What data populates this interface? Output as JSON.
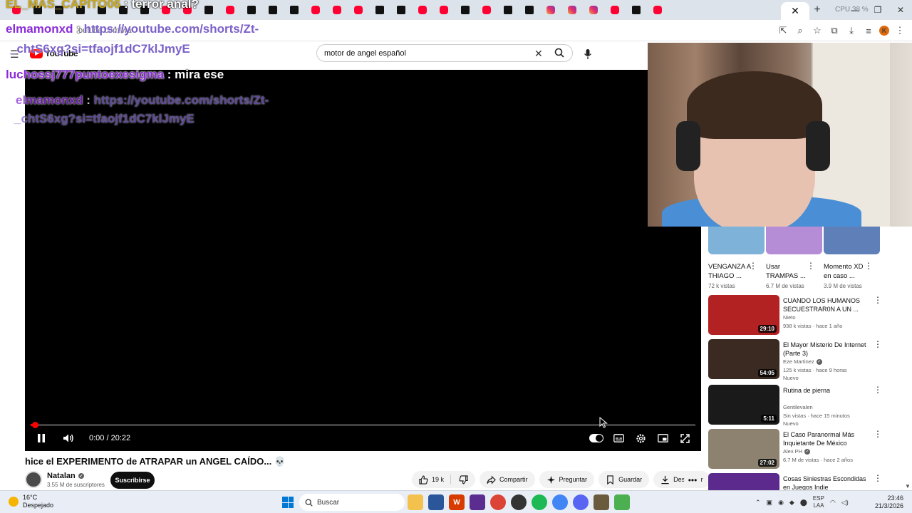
{
  "browser": {
    "url_fragment": "outube.com/wa",
    "cpu_label": "CPU 38 %",
    "new_tab_symbol": "+",
    "close_tab_symbol": "✕",
    "profile_initial": "K",
    "tab_favicons": [
      "yt",
      "tt",
      "tt",
      "tt",
      "tt",
      "tt",
      "tt",
      "yt",
      "yt",
      "tt",
      "yt",
      "tt",
      "tt",
      "tt",
      "yt",
      "yt",
      "yt",
      "tt",
      "tt",
      "yt",
      "yt",
      "tt",
      "yt",
      "tt",
      "tt",
      "ig",
      "ig",
      "ig",
      "yt",
      "tt",
      "yt"
    ]
  },
  "youtube": {
    "logo_text": "YouTube",
    "search": {
      "value": "motor de angel español"
    },
    "player": {
      "time": "0:00 / 20:22",
      "progress": 0.01
    },
    "video": {
      "title": "hice el EXPERIMENTO de ATRAPAR un ANGEL CAÍDO... 💀",
      "channel": "Natalan",
      "subscribers": "3.55 M de suscriptores",
      "subscribe_label": "Suscribirse",
      "likes": "19 k",
      "share_label": "Compartir",
      "ask_label": "Preguntar",
      "save_label": "Guardar",
      "download_label": "Descargar"
    },
    "shorts": [
      {
        "title": "VENGANZA A THIAGO ...",
        "views": "72 k vistas",
        "color": "#7fb2d8"
      },
      {
        "title": "Usar TRAMPAS ...",
        "views": "6.7 M de vistas",
        "color": "#b58cd6"
      },
      {
        "title": "Momento XD en caso ...",
        "views": "3.9 M de vistas",
        "color": "#5f7fb8"
      }
    ],
    "recommendations": [
      {
        "title": "CUANDO LOS HUMANOS SECUESTRAR0N A UN ...",
        "channel": "Nieto",
        "verified": false,
        "meta": "938 k vistas · hace 1 año",
        "badge": "",
        "duration": "29:10",
        "color": "#b22222"
      },
      {
        "title": "El Mayor Misterio De Internet (Parte 3)",
        "channel": "Eze Martinez",
        "verified": true,
        "meta": "125 k vistas · hace 9 horas",
        "badge": "Nuevo",
        "duration": "54:05",
        "color": "#3b2a22"
      },
      {
        "title": "Rutina de pierna",
        "channel": "Gentilevalen",
        "verified": false,
        "meta": "Sin vistas · hace 15 minutos",
        "badge": "Nuevo",
        "duration": "5:11",
        "color": "#1a1a1a"
      },
      {
        "title": "El Caso Paranormal Más Inquietante De México",
        "channel": "Alex PH",
        "verified": true,
        "meta": "6.7 M de vistas · hace 2 años",
        "badge": "",
        "duration": "27:02",
        "color": "#8d8270"
      },
      {
        "title": "Cosas Siniestras Escondidas en Juegos Indie",
        "channel": "",
        "verified": false,
        "meta": "",
        "badge": "",
        "duration": "",
        "color": "#5b2a8c"
      }
    ]
  },
  "chat": {
    "line1_user": "EL_MAS_CAPITO06",
    "line1_msg": ": terror anal?",
    "line2_user": "elmamonxd",
    "line2_sep": ":",
    "line2_link_a": "https://youtube.com/shorts/Zt-",
    "line2_link_b": "_chtS6xg?si=tfaojf1dC7klJmyE",
    "line3_user": "luchossj777puntoexesigma",
    "line3_msg": ": mira ese",
    "line4_user": "elmamonxd",
    "line4_sep": ":",
    "line4_link_a": "https://youtube.com/shorts/Zt-",
    "line4_link_b": "_chtS6xg?si=tfaojf1dC7klJmyE"
  },
  "taskbar": {
    "temp": "16°C",
    "weather": "Despejado",
    "search_label": "Buscar",
    "lang_top": "ESP",
    "lang_bottom": "LAA",
    "time": "23:46",
    "date": "21/3/2026"
  }
}
